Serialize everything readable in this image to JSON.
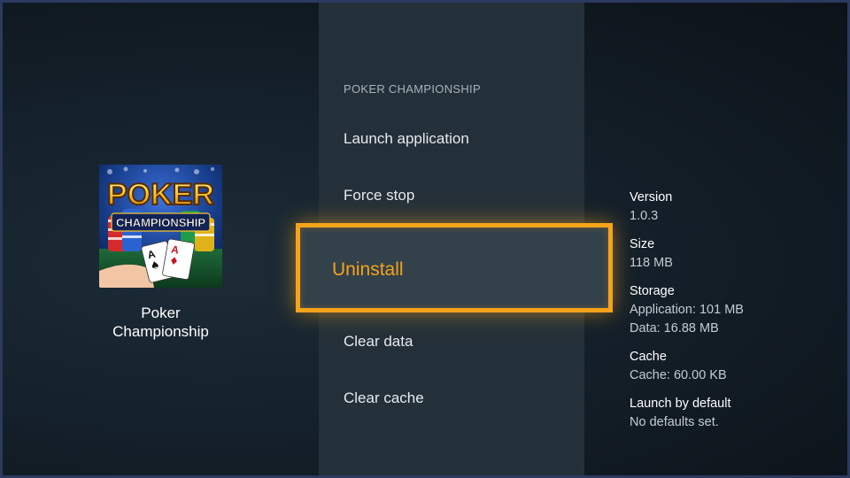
{
  "app": {
    "name": "Poker\nChampionship",
    "icon_title_line1": "POKER",
    "icon_title_line2": "CHAMPIONSHIP",
    "icon_cards": "A♠ A♦"
  },
  "menu": {
    "header": "POKER CHAMPIONSHIP",
    "items": [
      {
        "label": "Launch application"
      },
      {
        "label": "Force stop"
      },
      {
        "label": "Uninstall"
      },
      {
        "label": "Clear data"
      },
      {
        "label": "Clear cache"
      }
    ],
    "focused_index": 2
  },
  "info": {
    "version_label": "Version",
    "version_value": "1.0.3",
    "size_label": "Size",
    "size_value": "118 MB",
    "storage_label": "Storage",
    "storage_app": "Application: 101 MB",
    "storage_data": "Data: 16.88 MB",
    "cache_label": "Cache",
    "cache_value": "Cache: 60.00 KB",
    "launch_default_label": "Launch by default",
    "launch_default_value": "No defaults set."
  },
  "colors": {
    "focus_accent": "#f6a31a",
    "panel_bg": "#243039",
    "screen_border": "#2b3a5e"
  }
}
